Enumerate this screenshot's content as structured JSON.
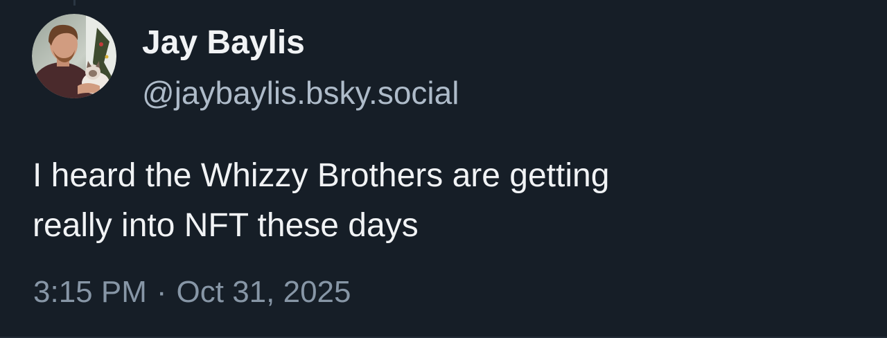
{
  "post": {
    "author": {
      "display_name": "Jay Baylis",
      "handle": "@jaybaylis.bsky.social",
      "avatar_icon": "user-avatar-photo"
    },
    "text_lines": [
      "I heard the Whizzy Brothers are getting",
      "really into NFT these days"
    ],
    "time": "3:15 PM",
    "separator": "·",
    "date": "Oct 31, 2025"
  },
  "colors": {
    "background": "#161e27",
    "primary_text": "#f1f3f5",
    "handle_text": "#aebbc9",
    "meta_text": "#8796a6"
  }
}
